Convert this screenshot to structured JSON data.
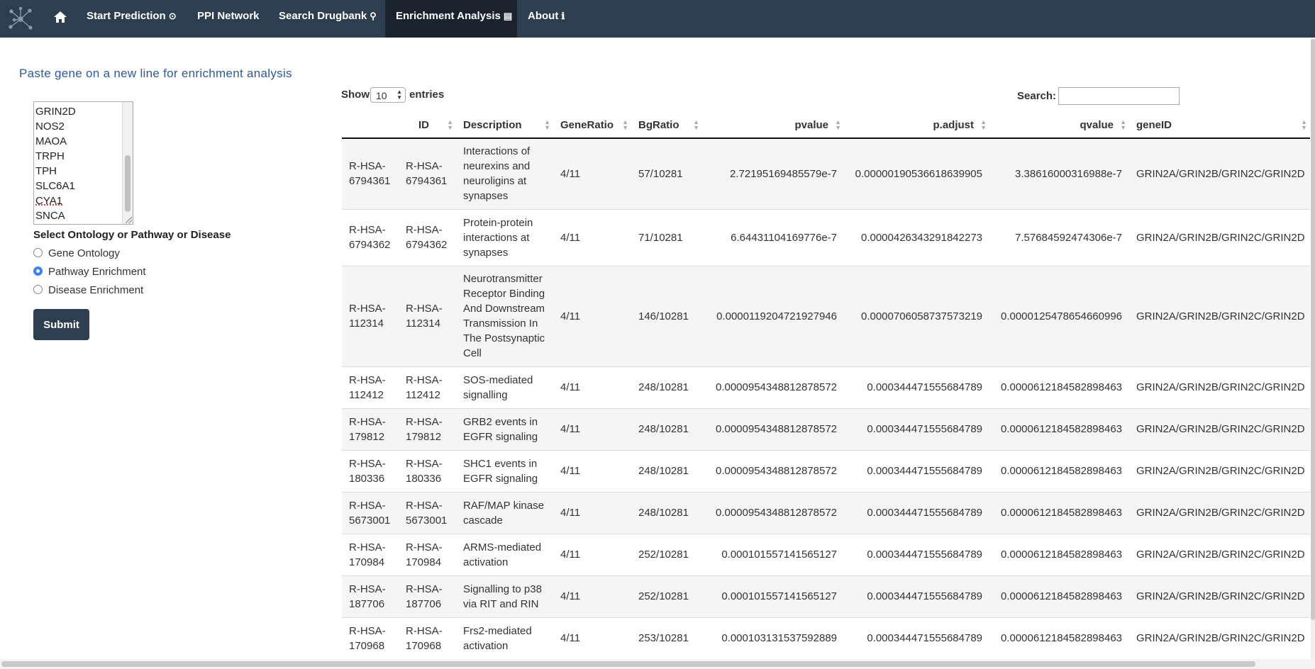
{
  "navbar": {
    "items": [
      {
        "label": "Start Prediction",
        "glyph": "⊙"
      },
      {
        "label": "PPI Network",
        "glyph": ""
      },
      {
        "label": "Search Drugbank",
        "glyph": "🔍"
      },
      {
        "label": "Enrichment Analysis",
        "glyph": "▤"
      },
      {
        "label": "About",
        "glyph": "ℹ"
      }
    ],
    "active": "Enrichment Analysis"
  },
  "left_panel": {
    "lead": "Paste gene on a new line for enrichment analysis",
    "genes": [
      "GRIN2D",
      "NOS2",
      "MAOA",
      "TRPH",
      "TPH",
      "SLC6A1",
      "CYA1",
      "SNCA"
    ],
    "select_label": "Select Ontology or Pathway or Disease",
    "options": [
      "Gene Ontology",
      "Pathway Enrichment",
      "Disease Enrichment"
    ],
    "selected_option": "Pathway Enrichment",
    "submit_label": "Submit"
  },
  "table_controls": {
    "show_label": "Show",
    "length_value": "10",
    "entries_label": "entries",
    "search_label": "Search:",
    "search_value": ""
  },
  "table": {
    "columns": [
      "",
      "ID",
      "Description",
      "GeneRatio",
      "BgRatio",
      "pvalue",
      "p.adjust",
      "qvalue",
      "geneID"
    ],
    "rows": [
      [
        "R-HSA-6794361",
        "R-HSA-6794361",
        "Interactions of neurexins and neuroligins at synapses",
        "4/11",
        "57/10281",
        "2.72195169485579e-7",
        "0.00000190536618639905",
        "3.38616000316988e-7",
        "GRIN2A/GRIN2B/GRIN2C/GRIN2D"
      ],
      [
        "R-HSA-6794362",
        "R-HSA-6794362",
        "Protein-protein interactions at synapses",
        "4/11",
        "71/10281",
        "6.64431104169776e-7",
        "0.0000426343291842273",
        "7.57684592474306e-7",
        "GRIN2A/GRIN2B/GRIN2C/GRIN2D"
      ],
      [
        "R-HSA-112314",
        "R-HSA-112314",
        "Neurotransmitter Receptor Binding And Downstream Transmission In The Postsynaptic Cell",
        "4/11",
        "146/10281",
        "0.0000119204721927946",
        "0.0000706058737573219",
        "0.0000125478654660996",
        "GRIN2A/GRIN2B/GRIN2C/GRIN2D"
      ],
      [
        "R-HSA-112412",
        "R-HSA-112412",
        "SOS-mediated signalling",
        "4/11",
        "248/10281",
        "0.0000954348812878572",
        "0.000344471555684789",
        "0.0000612184582898463",
        "GRIN2A/GRIN2B/GRIN2C/GRIN2D"
      ],
      [
        "R-HSA-179812",
        "R-HSA-179812",
        "GRB2 events in EGFR signaling",
        "4/11",
        "248/10281",
        "0.0000954348812878572",
        "0.000344471555684789",
        "0.0000612184582898463",
        "GRIN2A/GRIN2B/GRIN2C/GRIN2D"
      ],
      [
        "R-HSA-180336",
        "R-HSA-180336",
        "SHC1 events in EGFR signaling",
        "4/11",
        "248/10281",
        "0.0000954348812878572",
        "0.000344471555684789",
        "0.0000612184582898463",
        "GRIN2A/GRIN2B/GRIN2C/GRIN2D"
      ],
      [
        "R-HSA-5673001",
        "R-HSA-5673001",
        "RAF/MAP kinase cascade",
        "4/11",
        "248/10281",
        "0.0000954348812878572",
        "0.000344471555684789",
        "0.0000612184582898463",
        "GRIN2A/GRIN2B/GRIN2C/GRIN2D"
      ],
      [
        "R-HSA-170984",
        "R-HSA-170984",
        "ARMS-mediated activation",
        "4/11",
        "252/10281",
        "0.000101557141565127",
        "0.000344471555684789",
        "0.0000612184582898463",
        "GRIN2A/GRIN2B/GRIN2C/GRIN2D"
      ],
      [
        "R-HSA-187706",
        "R-HSA-187706",
        "Signalling to p38 via RIT and RIN",
        "4/11",
        "252/10281",
        "0.000101557141565127",
        "0.000344471555684789",
        "0.0000612184582898463",
        "GRIN2A/GRIN2B/GRIN2C/GRIN2D"
      ],
      [
        "R-HSA-170968",
        "R-HSA-170968",
        "Frs2-mediated activation",
        "4/11",
        "253/10281",
        "0.000103131537592889",
        "0.000344471555684789",
        "0.0000612184582898463",
        "GRIN2A/GRIN2B/GRIN2C/GRIN2D"
      ]
    ]
  },
  "colors": {
    "navbar": "#2c3e50",
    "navbar_active": "#1a242f",
    "accent_blue": "#3b82f6",
    "lead_text": "#2c5aa0"
  }
}
